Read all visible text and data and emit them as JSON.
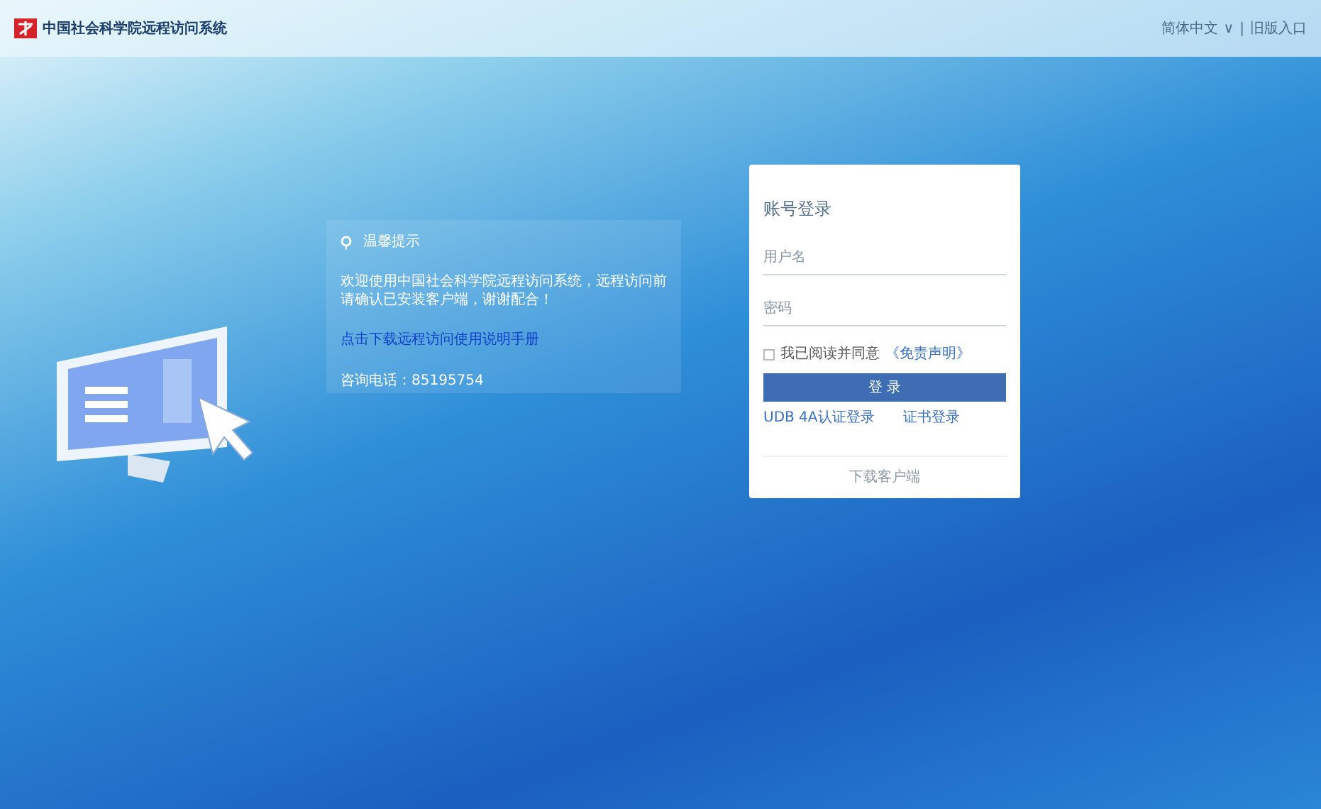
{
  "header": {
    "logo_text": "中国社会科学院远程访问系统",
    "language": "简体中文",
    "language_caret": "∨",
    "separator": "|",
    "old_version": "旧版入口"
  },
  "notice": {
    "title": "温馨提示",
    "message": "欢迎使用中国社会科学院远程访问系统，远程访问前请确认已安装客户端，谢谢配合！",
    "link": "点击下载远程访问使用说明手册",
    "phone": "咨询电话：85195754"
  },
  "login": {
    "title": "账号登录",
    "username": {
      "placeholder": "用户名"
    },
    "password": {
      "placeholder": "密码"
    },
    "agree": {
      "label": "我已阅读并同意",
      "link": "《免责声明》",
      "checked": false
    },
    "submit": "登 录",
    "alt_links": [
      "UDB 4A认证登录",
      "证书登录"
    ],
    "footer": "下载客户端"
  }
}
